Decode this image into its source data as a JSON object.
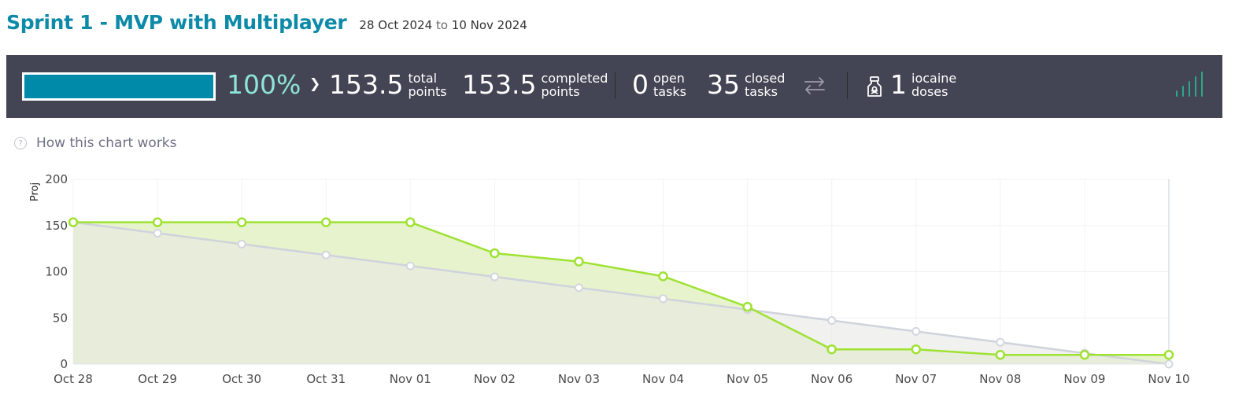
{
  "header": {
    "title": "Sprint 1 - MVP with Multiplayer",
    "start_date": "28 Oct 2024",
    "to_label": "to",
    "end_date": "10 Nov 2024"
  },
  "stats": {
    "progress_fraction": 1.0,
    "percent": "100%",
    "total_points": "153.5",
    "total_label_1": "total",
    "total_label_2": "points",
    "completed_points": "153.5",
    "completed_label_1": "completed",
    "completed_label_2": "points",
    "open_tasks": "0",
    "open_label_1": "open",
    "open_label_2": "tasks",
    "closed_tasks": "35",
    "closed_label_1": "closed",
    "closed_label_2": "tasks",
    "iocaine_doses": "1",
    "iocaine_label_1": "iocaine",
    "iocaine_label_2": "doses"
  },
  "icons": {
    "toggle": "chevron-down-icon",
    "swap": "swap-arrows-icon",
    "potion": "iocaine-potion-icon",
    "signal": "signal-bars-icon",
    "help": "help-circle-icon"
  },
  "colors": {
    "title": "#0d8aa8",
    "stats_bg": "#444554",
    "progress_fill": "#008aaa",
    "percent": "#8de4da",
    "actual_line": "#9ee232",
    "actual_fill": "#d9e6bd",
    "ideal_line": "#cfd3dc",
    "ideal_fill": "#efefef"
  },
  "help_link": "How this chart works",
  "chart_data": {
    "type": "line",
    "ylabel": "Proj",
    "ylim": [
      0,
      200
    ],
    "yticks": [
      "0",
      "50",
      "100",
      "150",
      "200"
    ],
    "categories": [
      "Oct 28",
      "Oct 29",
      "Oct 30",
      "Oct 31",
      "Nov 01",
      "Nov 02",
      "Nov 03",
      "Nov 04",
      "Nov 05",
      "Nov 06",
      "Nov 07",
      "Nov 08",
      "Nov 09",
      "Nov 10"
    ],
    "series": [
      {
        "name": "",
        "role": "ideal",
        "values": [
          153.5,
          141.7,
          129.9,
          118.1,
          106.3,
          94.5,
          82.7,
          70.8,
          59.0,
          47.2,
          35.4,
          23.6,
          11.8,
          0
        ]
      },
      {
        "name": "",
        "role": "actual",
        "values": [
          153.5,
          153.5,
          153.5,
          153.5,
          153.5,
          120,
          111,
          95,
          62,
          16,
          16,
          10,
          10,
          10
        ]
      }
    ],
    "grid": true
  }
}
